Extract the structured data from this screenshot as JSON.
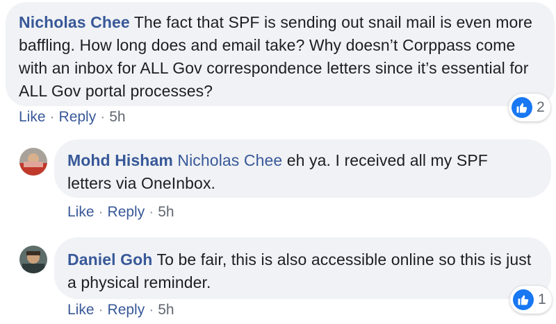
{
  "comments": [
    {
      "author": "Nicholas Chee",
      "mention": "",
      "text": " The fact that SPF is sending out snail mail is even more baffling. How long does and email take? Why doesn’t Corppass come with an inbox for ALL Gov correspondence letters since it’s essential for ALL Gov portal processes?",
      "like_label": "Like",
      "reply_label": "Reply",
      "time": "5h",
      "reaction_count": "2"
    },
    {
      "author": "Mohd Hisham",
      "mention": "Nicholas Chee",
      "text": " eh ya. I received all my SPF letters via OneInbox.",
      "like_label": "Like",
      "reply_label": "Reply",
      "time": "5h"
    },
    {
      "author": "Daniel Goh",
      "mention": "",
      "text": " To be fair, this is also accessible online so this is just a physical reminder.",
      "like_label": "Like",
      "reply_label": "Reply",
      "time": "5h",
      "reaction_count": "1"
    }
  ],
  "separator": "·",
  "icons": {
    "reaction": "thumbs-up-icon",
    "avatar": "avatar"
  },
  "colors": {
    "link": "#385898",
    "bubble": "#f0f2f5",
    "like_blue": "#1877f2",
    "meta": "#606770"
  }
}
